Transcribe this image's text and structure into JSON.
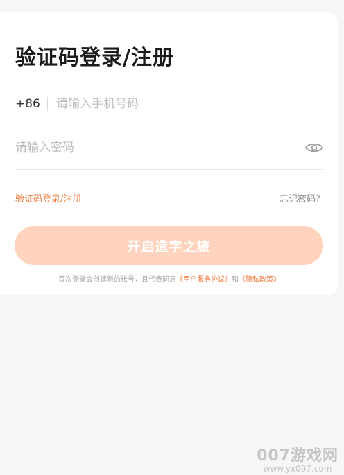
{
  "login": {
    "title": "验证码登录/注册",
    "phone": {
      "country_code": "+86",
      "placeholder": "请输入手机号码"
    },
    "password": {
      "placeholder": "请输入密码",
      "toggle_icon": "eye-icon"
    },
    "links": {
      "switch_mode": "验证码登录/注册",
      "forgot": "忘记密码?"
    },
    "submit_label": "开启造字之旅",
    "agreement": {
      "prefix": "首次登录会创建新的账号，且代表同意",
      "terms": "《用户服务协议》",
      "and": "和",
      "privacy": "《隐私政策》"
    }
  },
  "watermark": {
    "main": "007游戏网",
    "url": "www.yx007.com"
  },
  "colors": {
    "accent": "#f07a3c",
    "button_bg": "#ffd3bd",
    "page_bg": "#f6f6f6"
  }
}
